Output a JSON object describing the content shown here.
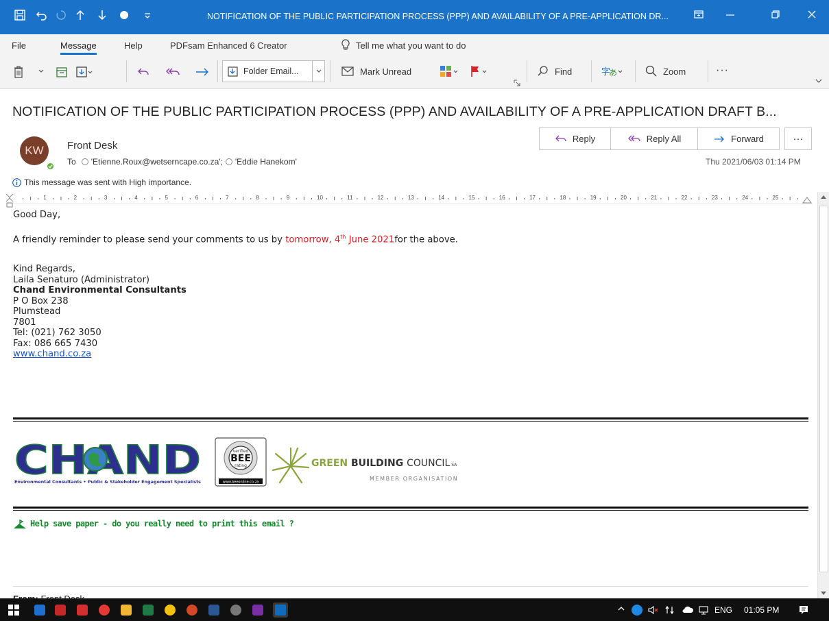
{
  "window": {
    "title": "NOTIFICATION OF THE PUBLIC PARTICIPATION PROCESS (PPP) AND AVAILABILITY OF A PRE-APPLICATION DR...",
    "accent_color": "#1a72c9"
  },
  "menu": {
    "items": [
      "File",
      "Message",
      "Help",
      "PDFsam Enhanced 6 Creator"
    ],
    "active": "Message",
    "tell_me": "Tell me what you want to do"
  },
  "ribbon": {
    "folder_select": "Folder Email...",
    "mark_unread": "Mark Unread",
    "find": "Find",
    "zoom": "Zoom",
    "more": "···"
  },
  "message": {
    "subject": "NOTIFICATION OF THE PUBLIC PARTICIPATION PROCESS (PPP) AND AVAILABILITY OF A PRE-APPLICATION DRAFT B...",
    "avatar_initials": "KW",
    "sender": "Front Desk",
    "to_label": "To",
    "recipient_1": "'Etienne.Roux@wetserncape.co.za';",
    "recipient_2": "'Eddie Hanekom'",
    "date": "Thu 2021/06/03 01:14 PM",
    "importance": "This message was sent with High importance.",
    "actions": {
      "reply": "Reply",
      "reply_all": "Reply All",
      "forward": "Forward",
      "more": "···"
    }
  },
  "ruler": {
    "numbers": [
      "1",
      "2",
      "3",
      "4",
      "5",
      "6",
      "7",
      "8",
      "9",
      "10",
      "11",
      "12",
      "13",
      "14",
      "15",
      "16",
      "17",
      "18",
      "19",
      "20",
      "21",
      "22",
      "23",
      "24",
      "25"
    ]
  },
  "body": {
    "greeting": "Good Day,",
    "reminder_before": "A friendly reminder to please send your comments to us by ",
    "reminder_highlight_1": "tomorrow, 4",
    "reminder_sup": "th",
    "reminder_highlight_2": " June 2021",
    "reminder_after": "for the above.",
    "highlight_color": "#e31b23",
    "signature": {
      "closing": "Kind Regards,",
      "name": "Laila Senaturo (Administrator)",
      "company": "Chand Environmental Consultants",
      "address_1": "P O Box 238",
      "address_2": "Plumstead",
      "address_3": "7801",
      "tel": "Tel:  (021) 762 3050",
      "fax": "Fax: 086 665 7430",
      "website": "www.chand.co.za"
    },
    "logos": {
      "chand_wordmark": "CHAND",
      "chand_tagline": "Environmental Consultants • Public & Stakeholder Engagement Specialists",
      "bee_text": "BEE",
      "bee_top": "verified",
      "bee_bottom": "rating",
      "bee_site": "www.beeonline.co.za",
      "gbc_green": "GREEN ",
      "gbc_building": "BUILDING ",
      "gbc_council": "COUNCIL",
      "gbc_sa": " SA",
      "gbc_member": "MEMBER ORGANISATION"
    },
    "save_paper": "Help save paper - do you really need to print this email  ?",
    "from_label": "From:",
    "from_value": "Front Desk"
  },
  "taskbar": {
    "language": "ENG",
    "time": "01:05 PM"
  }
}
